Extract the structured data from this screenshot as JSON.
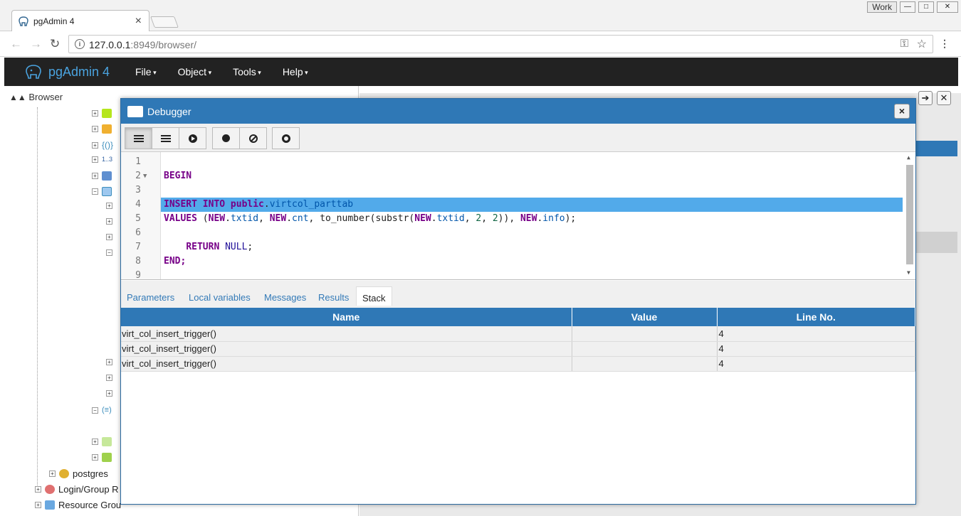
{
  "browser_tab": {
    "title": "pgAdmin 4",
    "close": "×"
  },
  "window_controls": {
    "profile": "Work",
    "minimize": "—",
    "restore": "□",
    "close": "✕"
  },
  "address": {
    "url_host": "127.0.0.1",
    "url_rest": ":8949/browser/",
    "back": "←",
    "forward": "→",
    "reload": "↻",
    "info": "i",
    "key": "⚿",
    "star": "☆",
    "menu": "⋮"
  },
  "app": {
    "brand": "pgAdmin 4",
    "menu": [
      "File",
      "Object",
      "Tools",
      "Help"
    ]
  },
  "browser_panel": {
    "title": "Browser",
    "tree": [
      {
        "label": "postgres",
        "icon": "database-icon"
      },
      {
        "label": "Login/Group R",
        "icon": "role-icon"
      },
      {
        "label": "Resource Grou",
        "icon": "resource-group-icon"
      }
    ],
    "small_label": "1..3"
  },
  "debugger": {
    "title": "Debugger",
    "close": "×",
    "toolbar": [
      "step-into",
      "step-over",
      "continue",
      "toggle-breakpoint",
      "clear-breakpoints",
      "stop"
    ],
    "code_lines": [
      {
        "n": "1",
        "fold": ""
      },
      {
        "n": "2",
        "fold": "▼"
      },
      {
        "n": "3",
        "fold": ""
      },
      {
        "n": "4",
        "fold": ""
      },
      {
        "n": "5",
        "fold": ""
      },
      {
        "n": "6",
        "fold": ""
      },
      {
        "n": "7",
        "fold": ""
      },
      {
        "n": "8",
        "fold": ""
      },
      {
        "n": "9",
        "fold": ""
      }
    ],
    "code": {
      "begin": "BEGIN",
      "insert": "INSERT INTO",
      "public": "public",
      "dot": ".",
      "table": "virtcol_parttab",
      "values": "VALUES",
      "open": " (",
      "new": "NEW",
      "txtid": "txtid",
      "comma": ", ",
      "cnt": "cnt",
      "to_number": "to_number(substr(",
      "two": "2",
      "close2": ")), ",
      "info": "info",
      "end_stmt": ");",
      "return": "RETURN",
      "null": "NULL",
      "semi": ";",
      "end": "END;"
    },
    "panel_tabs": [
      "Parameters",
      "Local variables",
      "Messages",
      "Results",
      "Stack"
    ],
    "active_tab": "Stack",
    "stack": {
      "columns": [
        "Name",
        "Value",
        "Line No."
      ],
      "rows": [
        {
          "name": "virt_col_insert_trigger()",
          "value": "",
          "line": "4"
        },
        {
          "name": "virt_col_insert_trigger()",
          "value": "",
          "line": "4"
        },
        {
          "name": "virt_col_insert_trigger()",
          "value": "",
          "line": "4"
        }
      ]
    }
  },
  "colors": {
    "accent": "#2f78b6",
    "navbar": "#222222",
    "highlight": "#52aaea"
  }
}
